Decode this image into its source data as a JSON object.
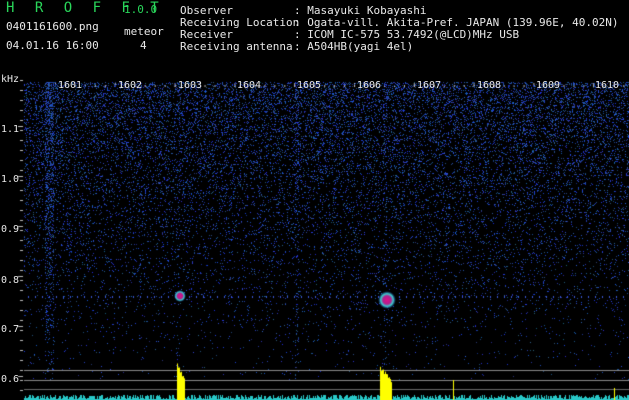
{
  "header": {
    "app_name": "H R O F F T",
    "version": "1.0.0",
    "filename": "0401161600.png",
    "datetime": "04.01.16 16:00",
    "meteor_label": "meteor",
    "meteor_count": "4",
    "fields": [
      {
        "label": "Observer",
        "value": ": Masayuki Kobayashi"
      },
      {
        "label": "Receiving Location",
        "value": ": Ogata-vill. Akita-Pref. JAPAN (139.96E, 40.02N)"
      },
      {
        "label": "Receiver",
        "value": ": ICOM IC-575 53.7492(@LCD)MHz USB"
      },
      {
        "label": "Receiving antenna",
        "value": ": A504HB(yagi 4el)"
      }
    ]
  },
  "axes": {
    "y_unit": "kHz",
    "y_ticks": [
      "1.1",
      "1.0",
      "0.9",
      "0.8",
      "0.7",
      "0.6"
    ],
    "x_ticks": [
      "1601",
      "1602",
      "1603",
      "1604",
      "1605",
      "1606",
      "1607",
      "1608",
      "1609",
      "1610"
    ]
  },
  "colors": {
    "background": "#000000",
    "noise": "#1f3fb0",
    "meteor_core": "#d0208a",
    "meteor_edge": "#3ad6d0",
    "bars": "#ffff00",
    "baseline_noise": "#28c8c8",
    "app_green": "#29d65a"
  },
  "meteor_echoes": [
    {
      "minute": 1603.0,
      "freq_khz": 0.77
    },
    {
      "minute": 1606.1,
      "freq_khz": 0.76
    }
  ]
}
